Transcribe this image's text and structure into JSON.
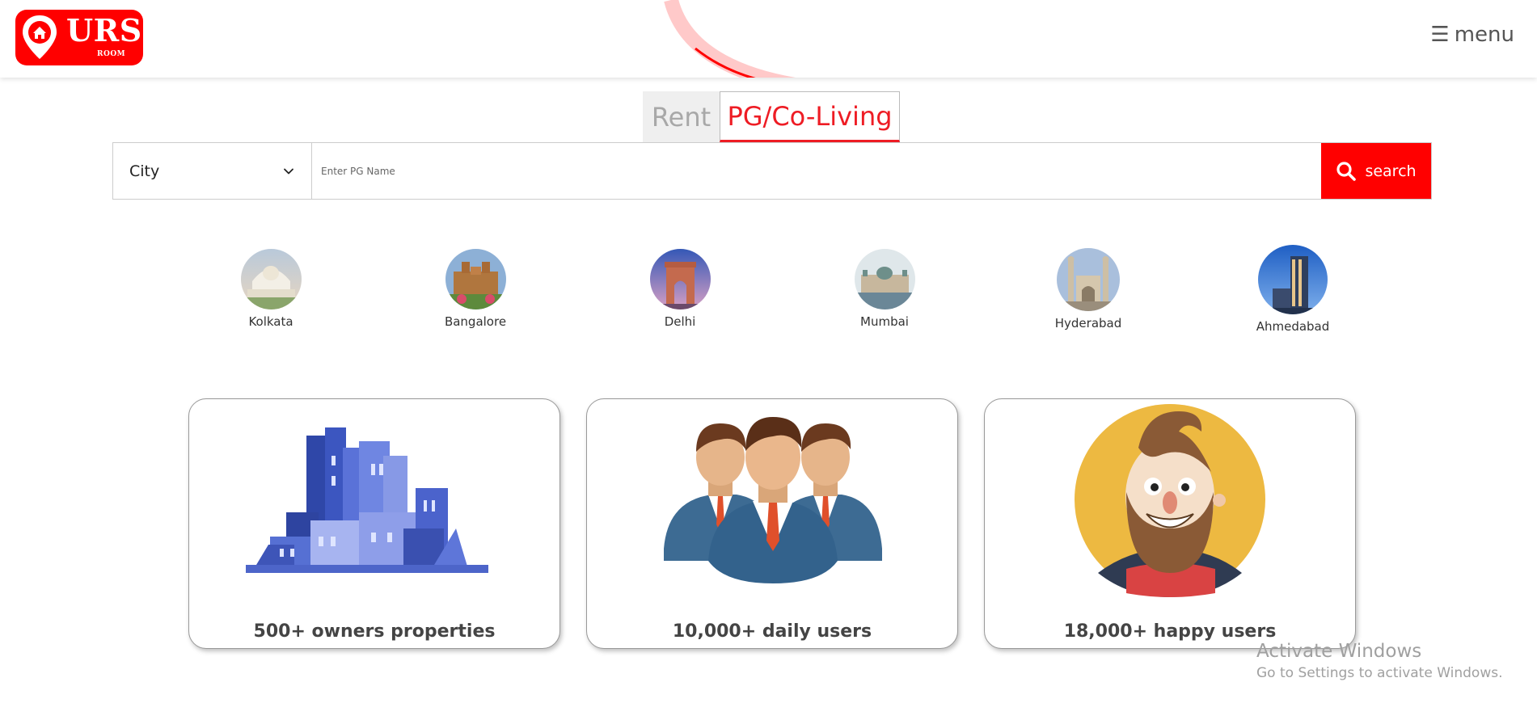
{
  "header": {
    "logo_text": "URS",
    "logo_sub": "ROOM",
    "menu_label": "menu",
    "menu_icon": "☰"
  },
  "tabs": [
    {
      "label": "Rent",
      "active": false
    },
    {
      "label": "PG/Co-Living",
      "active": true
    }
  ],
  "search": {
    "city_value": "City",
    "placeholder": "Enter PG Name",
    "button_label": "search"
  },
  "cities": [
    {
      "name": "Kolkata"
    },
    {
      "name": "Bangalore"
    },
    {
      "name": "Delhi"
    },
    {
      "name": "Mumbai"
    },
    {
      "name": "Hyderabad"
    },
    {
      "name": "Ahmedabad"
    }
  ],
  "stats": [
    {
      "label": "500+ owners properties",
      "icon": "buildings-illustration"
    },
    {
      "label": "10,000+ daily users",
      "icon": "users-group-illustration"
    },
    {
      "label": "18,000+ happy users",
      "icon": "happy-face-illustration"
    }
  ],
  "watermark": {
    "title": "Activate Windows",
    "subtitle": "Go to Settings to activate Windows."
  },
  "colors": {
    "brand": "#ff0000",
    "accent": "#ee1c24"
  }
}
